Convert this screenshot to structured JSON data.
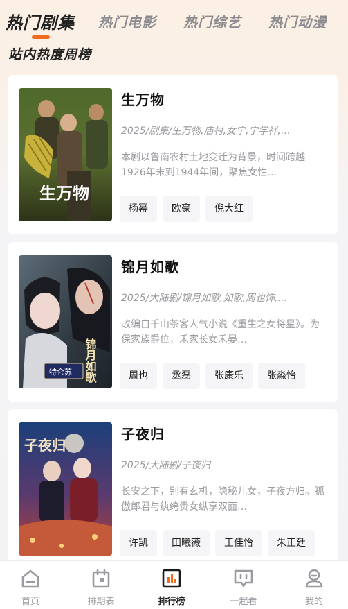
{
  "top_tabs": [
    {
      "label": "热门剧集",
      "active": true
    },
    {
      "label": "热门电影",
      "active": false
    },
    {
      "label": "热门综艺",
      "active": false
    },
    {
      "label": "热门动漫",
      "active": false
    }
  ],
  "section_title": "站内热度周榜",
  "accent_color": "#f26a1b",
  "items": [
    {
      "title": "生万物",
      "meta": "2025/剧集/生万物,庙村,女宁,宁学祥,…",
      "desc": "本剧以鲁南农村土地变迁为背景，时间跨越1926年末到1944年间，聚焦女性…",
      "cast": [
        "杨幂",
        "欧豪",
        "倪大红"
      ],
      "poster_text": "生万物"
    },
    {
      "title": "锦月如歌",
      "meta": "2025/大陆剧/锦月如歌,如歌,周也饰,…",
      "desc": "改编自千山茶客人气小说《重生之女将星》。为保家族爵位，禾家长女禾晏…",
      "cast": [
        "周也",
        "丞磊",
        "张康乐",
        "张淼怡"
      ],
      "poster_text": "锦月如歌",
      "poster_badge": "特仑苏"
    },
    {
      "title": "子夜归",
      "meta": "2025/大陆剧/子夜归",
      "desc": "长安之下，别有玄机，隐秘儿女，子夜方归。孤傲郎君与纨绔贵女纵享双面…",
      "cast": [
        "许凯",
        "田曦薇",
        "王佳怡",
        "朱正廷"
      ],
      "poster_text": "子夜归"
    }
  ],
  "bottom_nav": [
    {
      "label": "首页",
      "icon": "home-icon",
      "active": false
    },
    {
      "label": "排期表",
      "icon": "calendar-icon",
      "active": false
    },
    {
      "label": "排行榜",
      "icon": "ranking-icon",
      "active": true
    },
    {
      "label": "一起看",
      "icon": "watch-together-icon",
      "active": false
    },
    {
      "label": "我的",
      "icon": "profile-icon",
      "active": false
    }
  ]
}
